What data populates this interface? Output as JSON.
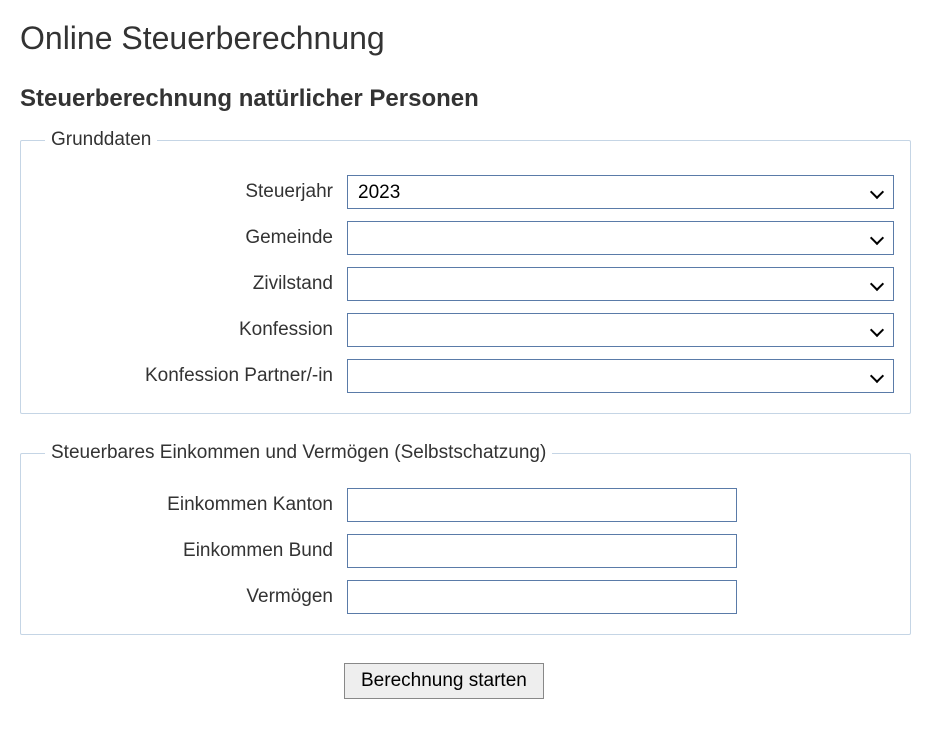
{
  "page": {
    "title": "Online Steuerberechnung",
    "subtitle": "Steuerberechnung natürlicher Personen"
  },
  "fieldset1": {
    "legend": "Grunddaten",
    "fields": {
      "steuerjahr": {
        "label": "Steuerjahr",
        "value": "2023"
      },
      "gemeinde": {
        "label": "Gemeinde",
        "value": ""
      },
      "zivilstand": {
        "label": "Zivilstand",
        "value": ""
      },
      "konfession": {
        "label": "Konfession",
        "value": ""
      },
      "konfession_partner": {
        "label": "Konfession Partner/-in",
        "value": ""
      }
    }
  },
  "fieldset2": {
    "legend": "Steuerbares Einkommen und Vermögen (Selbstschatzung)",
    "fields": {
      "einkommen_kanton": {
        "label": "Einkommen Kanton",
        "value": ""
      },
      "einkommen_bund": {
        "label": "Einkommen Bund",
        "value": ""
      },
      "vermoegen": {
        "label": "Vermögen",
        "value": ""
      }
    }
  },
  "actions": {
    "submit": "Berechnung starten"
  }
}
